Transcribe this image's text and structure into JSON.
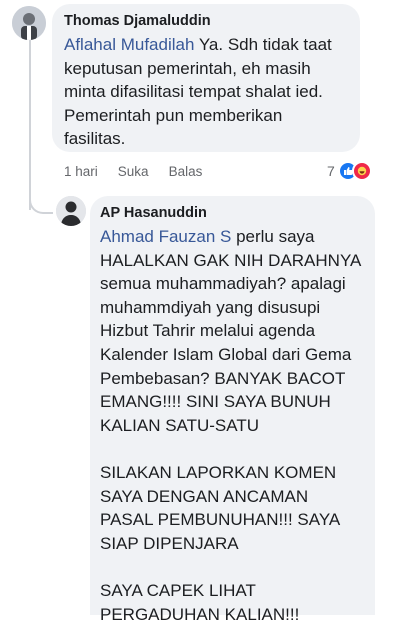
{
  "comments": [
    {
      "author": "Thomas Djamaluddin",
      "mention": "Aflahal Mufadilah",
      "text": " Ya. Sdh tidak taat keputusan pemerintah, eh masih minta difasilitasi tempat shalat ied. Pemerintah pun memberikan fasilitas.",
      "time": "1 hari",
      "like_label": "Suka",
      "reply_label": "Balas",
      "reaction_count": "7",
      "reactions": [
        "like-icon",
        "haha-icon"
      ]
    },
    {
      "author": "AP Hasanuddin",
      "mention": "Ahmad Fauzan S",
      "text": " perlu saya HALALKAN GAK NIH DARAHNYA semua muhammadiyah? apalagi muhammdiyah yang disusupi Hizbut Tahrir melalui agenda Kalender Islam Global dari Gema Pembebasan? BANYAK BACOT EMANG!!!! SINI SAYA BUNUH KALIAN SATU-SATU\n\nSILAKAN LAPORKAN KOMEN SAYA DENGAN ANCAMAN PASAL PEMBUNUHAN!!! SAYA SIAP DIPENJARA\n\nSAYA CAPEK LIHAT PERGADUHAN KALIAN!!!"
    }
  ],
  "colors": {
    "bubble": "#f0f2f5",
    "mention": "#385898",
    "like": "#1877f2",
    "haha": "#f02849"
  }
}
